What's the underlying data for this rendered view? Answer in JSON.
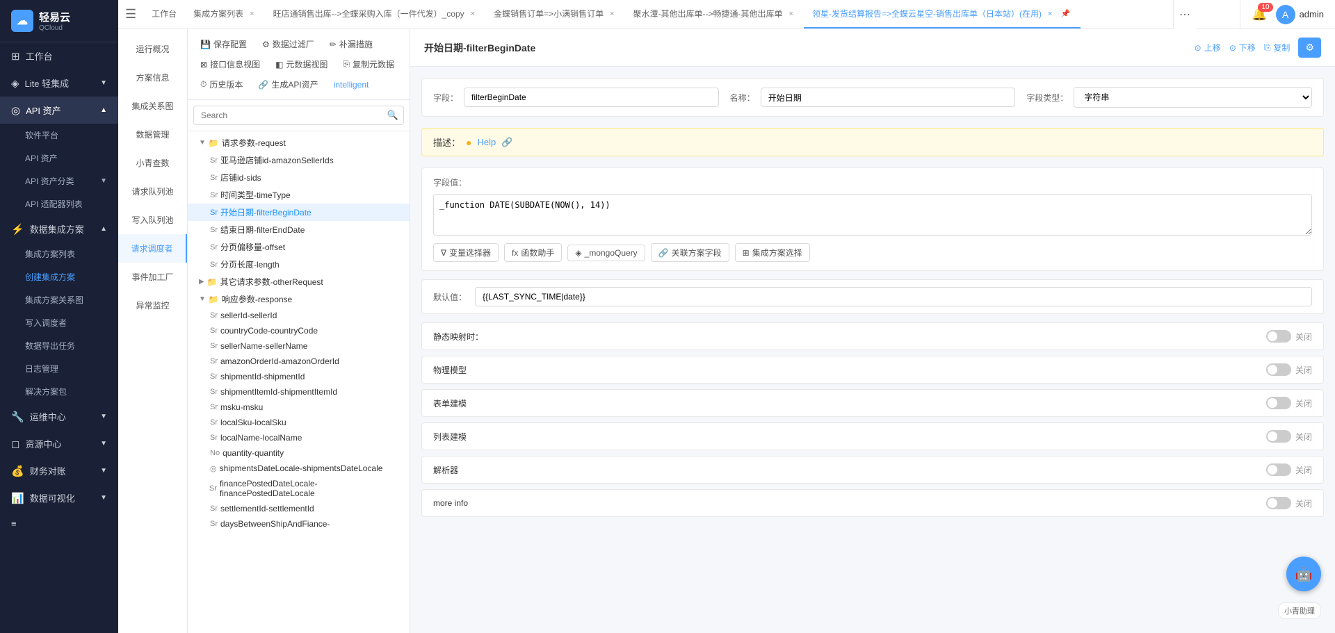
{
  "sidebar": {
    "logo": {
      "text": "轻易云",
      "sub": "QCloud"
    },
    "items": [
      {
        "id": "workbench",
        "label": "工作台",
        "icon": "⊞",
        "hasArrow": false
      },
      {
        "id": "lite",
        "label": "Lite 轻集成",
        "icon": "◈",
        "hasArrow": true
      },
      {
        "id": "api",
        "label": "API 资产",
        "icon": "◎",
        "hasArrow": true,
        "active": true
      },
      {
        "id": "software",
        "label": "软件平台",
        "icon": "",
        "sub": true
      },
      {
        "id": "api-asset",
        "label": "API 资产",
        "icon": "",
        "sub": true
      },
      {
        "id": "api-category",
        "label": "API 资产分类",
        "icon": "",
        "sub": true,
        "hasArrow": true
      },
      {
        "id": "api-adapter",
        "label": "API 适配器列表",
        "icon": "",
        "sub": true
      },
      {
        "id": "data-integration",
        "label": "数据集成方案",
        "icon": "⚡",
        "hasArrow": true
      },
      {
        "id": "integration-list",
        "label": "集成方案列表",
        "icon": "",
        "sub": true
      },
      {
        "id": "create-integration",
        "label": "创建集成方案",
        "icon": "",
        "sub": true,
        "active": true
      },
      {
        "id": "integration-graph",
        "label": "集成方案关系图",
        "icon": "",
        "sub": true
      },
      {
        "id": "write-scheduler",
        "label": "写入调度者",
        "icon": "",
        "sub": true
      },
      {
        "id": "data-export",
        "label": "数据导出任务",
        "icon": "",
        "sub": true
      },
      {
        "id": "log-mgmt",
        "label": "日志管理",
        "icon": "",
        "sub": true
      },
      {
        "id": "solution-pkg",
        "label": "解决方案包",
        "icon": "",
        "sub": true
      },
      {
        "id": "ops",
        "label": "运维中心",
        "icon": "🔧",
        "hasArrow": true
      },
      {
        "id": "resource",
        "label": "资源中心",
        "icon": "◻",
        "hasArrow": true
      },
      {
        "id": "finance",
        "label": "财务对账",
        "icon": "💰",
        "hasArrow": true
      },
      {
        "id": "data-viz",
        "label": "数据可视化",
        "icon": "📊",
        "hasArrow": true
      },
      {
        "id": "more",
        "label": "≡",
        "icon": "≡"
      }
    ]
  },
  "tabs": [
    {
      "id": "workbench",
      "label": "工作台",
      "closable": false
    },
    {
      "id": "integration-list",
      "label": "集成方案列表",
      "closable": true
    },
    {
      "id": "tab1",
      "label": "旺店通销售出库-->全蝶采购入库（一件代发）_copy",
      "closable": true
    },
    {
      "id": "tab2",
      "label": "金蝶销售订单=>小满销售订单",
      "closable": true
    },
    {
      "id": "tab3",
      "label": "聚水潭-其他出库单-->畅捷通-其他出库单",
      "closable": true
    },
    {
      "id": "tab4",
      "label": "领星-发货结算报告=>全蝶云星空-销售出库单（日本站）(在用)",
      "closable": true,
      "active": true
    }
  ],
  "left_nav": {
    "items": [
      {
        "id": "overview",
        "label": "运行概况"
      },
      {
        "id": "solution-info",
        "label": "方案信息"
      },
      {
        "id": "integration-graph",
        "label": "集成关系图"
      },
      {
        "id": "data-mgmt",
        "label": "数据管理"
      },
      {
        "id": "xiao-qing",
        "label": "小青查数"
      },
      {
        "id": "request-pool",
        "label": "请求队列池",
        "active": true
      },
      {
        "id": "write-pool",
        "label": "写入队列池"
      },
      {
        "id": "request-debugger",
        "label": "请求调度者",
        "active": true
      },
      {
        "id": "event-factory",
        "label": "事件加工厂"
      },
      {
        "id": "exception-monitor",
        "label": "异常监控"
      }
    ]
  },
  "toolbar": {
    "save_config": "保存配置",
    "data_filter": "数据过滤厂",
    "補漏措施": "补漏措施",
    "interface_view": "接口信息视图",
    "meta_view": "元数据视图",
    "replicate_data": "复制元数据",
    "history": "历史版本",
    "gen_api": "生成API资产",
    "intelligent": "intelligent"
  },
  "search": {
    "placeholder": "Search"
  },
  "tree": {
    "nodes": [
      {
        "id": "request-params",
        "label": "请求参数-request",
        "type": "folder",
        "level": 0,
        "expanded": true
      },
      {
        "id": "amazon-seller-ids",
        "label": "亚马逊店铺id-amazonSellerIds",
        "type": "Sr",
        "level": 1
      },
      {
        "id": "shop-id-sids",
        "label": "店铺id-sids",
        "type": "Sr",
        "level": 1
      },
      {
        "id": "time-type",
        "label": "时间类型-timeType",
        "type": "Sr",
        "level": 1
      },
      {
        "id": "filter-begin-date",
        "label": "开始日期-filterBeginDate",
        "type": "Sr",
        "level": 1,
        "selected": true
      },
      {
        "id": "filter-end-date",
        "label": "结束日期-filterEndDate",
        "type": "Sr",
        "level": 1
      },
      {
        "id": "offset",
        "label": "分页偏移量-offset",
        "type": "Sr",
        "level": 1
      },
      {
        "id": "length",
        "label": "分页长度-length",
        "type": "Sr",
        "level": 1
      },
      {
        "id": "other-request",
        "label": "其它请求参数-otherRequest",
        "type": "folder",
        "level": 0,
        "expanded": false
      },
      {
        "id": "response-params",
        "label": "响应参数-response",
        "type": "folder",
        "level": 0,
        "expanded": true
      },
      {
        "id": "seller-id",
        "label": "sellerId-sellerId",
        "type": "Sr",
        "level": 1
      },
      {
        "id": "country-code",
        "label": "countryCode-countryCode",
        "type": "Sr",
        "level": 1
      },
      {
        "id": "seller-name",
        "label": "sellerName-sellerName",
        "type": "Sr",
        "level": 1
      },
      {
        "id": "amazon-order-id",
        "label": "amazonOrderId-amazonOrderId",
        "type": "Sr",
        "level": 1
      },
      {
        "id": "shipment-id",
        "label": "shipmentId-shipmentId",
        "type": "Sr",
        "level": 1
      },
      {
        "id": "shipment-item-id",
        "label": "shipmentItemId-shipmentItemId",
        "type": "Sr",
        "level": 1
      },
      {
        "id": "msku",
        "label": "msku-msku",
        "type": "Sr",
        "level": 1
      },
      {
        "id": "local-sku",
        "label": "localSku-localSku",
        "type": "Sr",
        "level": 1
      },
      {
        "id": "local-name",
        "label": "localName-localName",
        "type": "Sr",
        "level": 1
      },
      {
        "id": "quantity",
        "label": "quantity-quantity",
        "type": "No",
        "level": 1
      },
      {
        "id": "shipments-date-locale",
        "label": "shipmentsDateLocale-shipmentsDateLocale",
        "type": "◎",
        "level": 1
      },
      {
        "id": "finance-posted-date-locale",
        "label": "financePostedDateLocale-financePostedDateLocale",
        "type": "Sr",
        "level": 1
      },
      {
        "id": "settlement-id",
        "label": "settlementId-settlementId",
        "type": "Sr",
        "level": 1
      },
      {
        "id": "days-between",
        "label": "daysBetweenShipAndFiance-",
        "type": "Sr",
        "level": 1
      }
    ]
  },
  "detail": {
    "title": "开始日期-filterBeginDate",
    "actions": {
      "up": "上移",
      "down": "下移",
      "copy": "复制"
    },
    "field_label": "字段：",
    "field_value": "filterBeginDate",
    "name_label": "名称：",
    "name_value": "开始日期",
    "type_label": "字段类型：",
    "type_value": "字符串",
    "desc_label": "描述：",
    "desc_help": "Help",
    "field_value_label": "字段值：",
    "field_value_content": "_function DATE(SUBDATE(NOW(), 14))",
    "buttons": {
      "var_selector": "变量选择器",
      "func_helper": "函数助手",
      "mongo_query": "_mongoQuery",
      "related_field": "关联方案字段",
      "integration_select": "集成方案选择"
    },
    "default_label": "默认值：",
    "default_value": "{{LAST_SYNC_TIME|date}}",
    "static_mapping_label": "静态映射时：",
    "physical_model_label": "物理模型",
    "table_build_label": "表单建模",
    "list_build_label": "列表建模",
    "parser_label": "解析器",
    "more_info_label": "more info",
    "toggle_off_text": "关闭"
  },
  "user": {
    "name": "admin",
    "badge": "10"
  }
}
